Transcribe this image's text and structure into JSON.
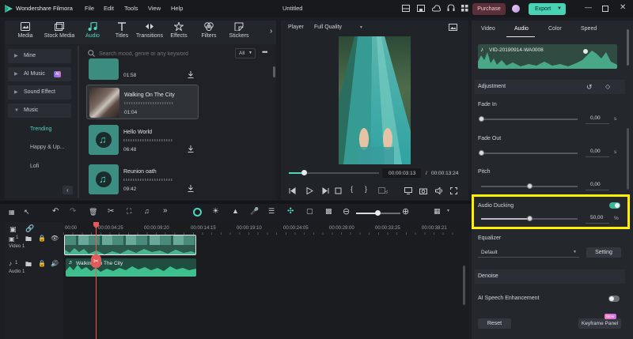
{
  "titlebar": {
    "app_name": "Wondershare Filmora",
    "menu": [
      "File",
      "Edit",
      "Tools",
      "View",
      "Help"
    ],
    "project_title": "Untitled",
    "purchase_label": "Purchase",
    "export_label": "Export"
  },
  "media_tabs": [
    {
      "label": "Media",
      "icon": "media-icon"
    },
    {
      "label": "Stock Media",
      "icon": "stock-media-icon"
    },
    {
      "label": "Audio",
      "icon": "music-note-icon",
      "active": true
    },
    {
      "label": "Titles",
      "icon": "titles-icon"
    },
    {
      "label": "Transitions",
      "icon": "transitions-icon"
    },
    {
      "label": "Effects",
      "icon": "effects-icon"
    },
    {
      "label": "Filters",
      "icon": "filters-icon"
    },
    {
      "label": "Stickers",
      "icon": "stickers-icon"
    }
  ],
  "sidebar": {
    "categories": [
      {
        "label": "Mine"
      },
      {
        "label": "AI Music",
        "badge": "AI"
      },
      {
        "label": "Sound Effect"
      },
      {
        "label": "Music",
        "expanded": true
      }
    ],
    "music_sub": [
      "Trending",
      "Happy & Up...",
      "Lofi"
    ]
  },
  "search": {
    "placeholder": "Search mood, genre or any keyword",
    "filter_value": "All"
  },
  "tracks": [
    {
      "title": "",
      "duration": "01:58"
    },
    {
      "title": "Walking On The City",
      "duration": "01:04",
      "selected": true
    },
    {
      "title": "Hello World",
      "duration": "06:48"
    },
    {
      "title": "Reunion oath",
      "duration": "09:42"
    }
  ],
  "player": {
    "label": "Player",
    "quality": "Full Quality",
    "current_time": "00:00:03:13",
    "separator": "/",
    "total_time": "00:00:13:24",
    "progress": 0.17
  },
  "right_panel": {
    "tabs": [
      "Video",
      "Audio",
      "Color",
      "Speed"
    ],
    "active_tab": "Audio",
    "clip_name": "VID-20190914-WA0008",
    "adjustment_title": "Adjustment",
    "fade_in": {
      "label": "Fade In",
      "value": "0,00",
      "unit": "s",
      "level": 0
    },
    "fade_out": {
      "label": "Fade Out",
      "value": "0,00",
      "unit": "s",
      "level": 0
    },
    "pitch": {
      "label": "Pitch",
      "value": "0,00",
      "level": 0.5
    },
    "audio_ducking": {
      "label": "Audio Ducking",
      "value": "50,00",
      "unit": "%",
      "level": 0.5,
      "enabled": true
    },
    "equalizer": {
      "label": "Equalizer",
      "value": "Default",
      "setting_label": "Setting"
    },
    "denoise_title": "Denoise",
    "ai_speech": {
      "label": "AI Speech Enhancement",
      "enabled": false
    },
    "reset_label": "Reset",
    "keyframe_label": "Keyframe Panel",
    "new_badge": "NEW"
  },
  "timeline": {
    "ruler": [
      "00:00",
      "00:00:04:25",
      "00:00:09:20",
      "00:00:14:15",
      "00:00:19:10",
      "00:00:24:05",
      "00:00:29:00",
      "00:00:33:25",
      "00:00:38:21"
    ],
    "video_track_label": "Video 1",
    "audio_track_label": "Audio 1",
    "video_track_num": "1",
    "audio_track_num": "1",
    "audio_clip_label": "Walking On The City"
  },
  "colors": {
    "accent": "#4fd6bd",
    "highlight": "#ffef00",
    "playhead": "#e25b5b",
    "audio_clip": "#2f8c72"
  }
}
